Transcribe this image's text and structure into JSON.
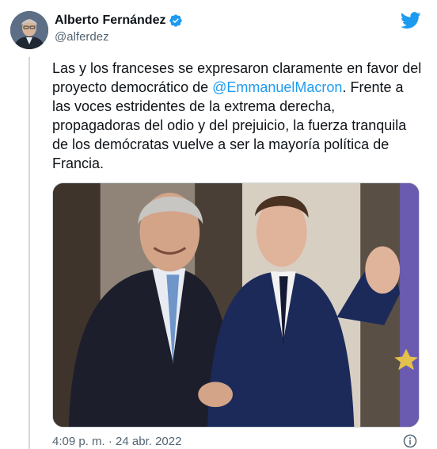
{
  "author": {
    "display_name": "Alberto Fernández",
    "handle": "@alferdez",
    "verified": true,
    "avatar_icon": "user-avatar"
  },
  "tweet": {
    "text_part1": "Las y los franceses se expresaron claramente en favor del proyecto democrático de ",
    "mention": "@EmmanuelMacron",
    "text_part2": ". Frente a las voces estridentes de la extrema derecha, propagadoras del odio y del prejuicio, la fuerza tranquila de los demócratas vuelve a ser la mayoría política de Francia.",
    "timestamp": "4:09 p. m. · 24 abr. 2022"
  },
  "icons": {
    "brand": "twitter-bird-icon",
    "verified": "verified-badge-icon",
    "info": "info-icon"
  },
  "colors": {
    "accent": "#1d9bf0",
    "text": "#0f1419",
    "secondary": "#536471",
    "border": "#cfd9de"
  }
}
